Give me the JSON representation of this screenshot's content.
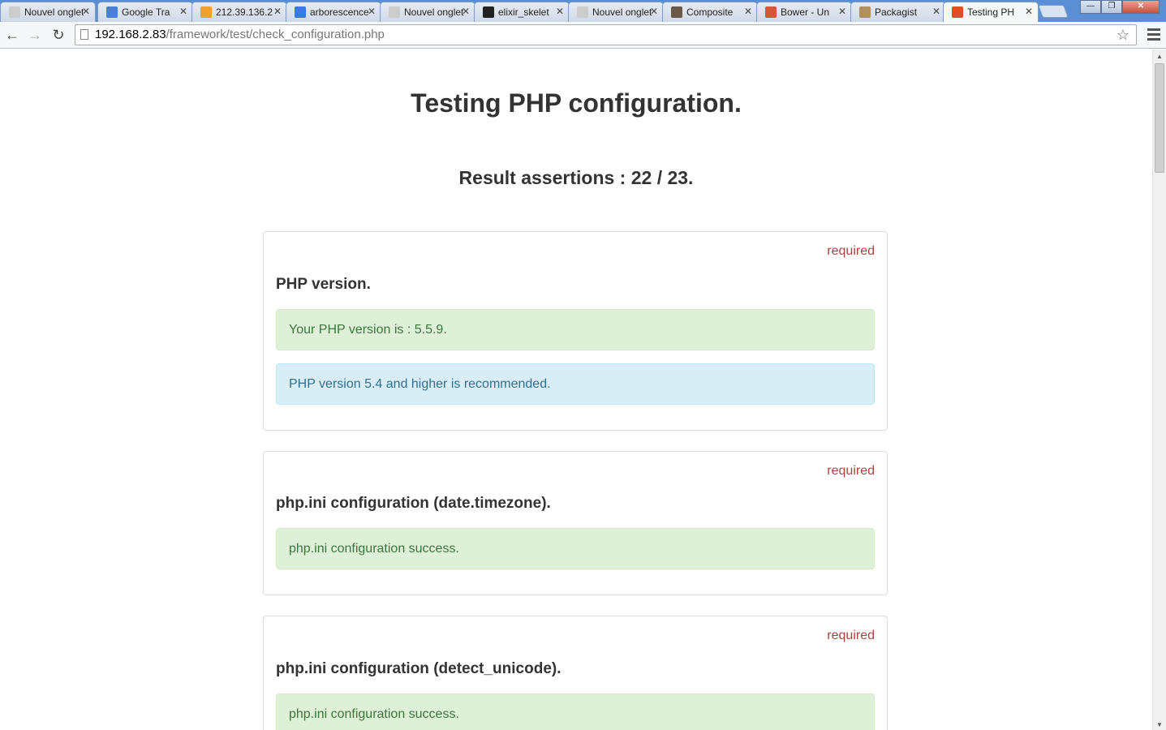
{
  "browser": {
    "tabs": [
      {
        "title": "Nouvel onglet",
        "icon": "blank-icon",
        "color": "#cccccc"
      },
      {
        "title": "Google Tra",
        "icon": "google-translate-icon",
        "color": "#4a7fd8"
      },
      {
        "title": "212.39.136.2",
        "icon": "phpmyadmin-icon",
        "color": "#f0a030"
      },
      {
        "title": "arborescence",
        "icon": "google-icon",
        "color": "#3b78e7"
      },
      {
        "title": "Nouvel onglet",
        "icon": "blank-icon",
        "color": "#cccccc"
      },
      {
        "title": "elixir_skelet",
        "icon": "github-icon",
        "color": "#222222"
      },
      {
        "title": "Nouvel onglet",
        "icon": "blank-icon",
        "color": "#cccccc"
      },
      {
        "title": "Composite",
        "icon": "composer-icon",
        "color": "#6b5a4a"
      },
      {
        "title": "Bower - Un",
        "icon": "bower-icon",
        "color": "#d4553a"
      },
      {
        "title": "Packagist",
        "icon": "packagist-icon",
        "color": "#b09060"
      },
      {
        "title": "Testing PH",
        "icon": "page-icon",
        "color": "#e0501e",
        "active": true
      }
    ],
    "close_glyph": "✕",
    "window_controls": {
      "minimize": "—",
      "maximize": "❐",
      "close": "✕"
    },
    "url": {
      "host": "192.168.2.83",
      "path": "/framework/test/check_configuration.php"
    },
    "nav": {
      "back": "←",
      "forward": "→",
      "reload": "↻",
      "star": "☆"
    }
  },
  "page": {
    "title": "Testing PHP configuration.",
    "result": "Result assertions : 22 / 23.",
    "cards": [
      {
        "level": "required",
        "heading": "PHP version.",
        "messages": [
          {
            "type": "success",
            "text": "Your PHP version is : 5.5.9."
          },
          {
            "type": "info",
            "text": "PHP version 5.4 and higher is recommended."
          }
        ]
      },
      {
        "level": "required",
        "heading": "php.ini configuration (date.timezone).",
        "messages": [
          {
            "type": "success",
            "text": "php.ini configuration success."
          }
        ]
      },
      {
        "level": "required",
        "heading": "php.ini configuration (detect_unicode).",
        "messages": [
          {
            "type": "success",
            "text": "php.ini configuration success."
          }
        ]
      }
    ]
  },
  "colors": {
    "success_bg": "#dff0d8",
    "success_text": "#3c763d",
    "info_bg": "#d9edf7",
    "info_text": "#31708f",
    "required_text": "#a94442"
  }
}
